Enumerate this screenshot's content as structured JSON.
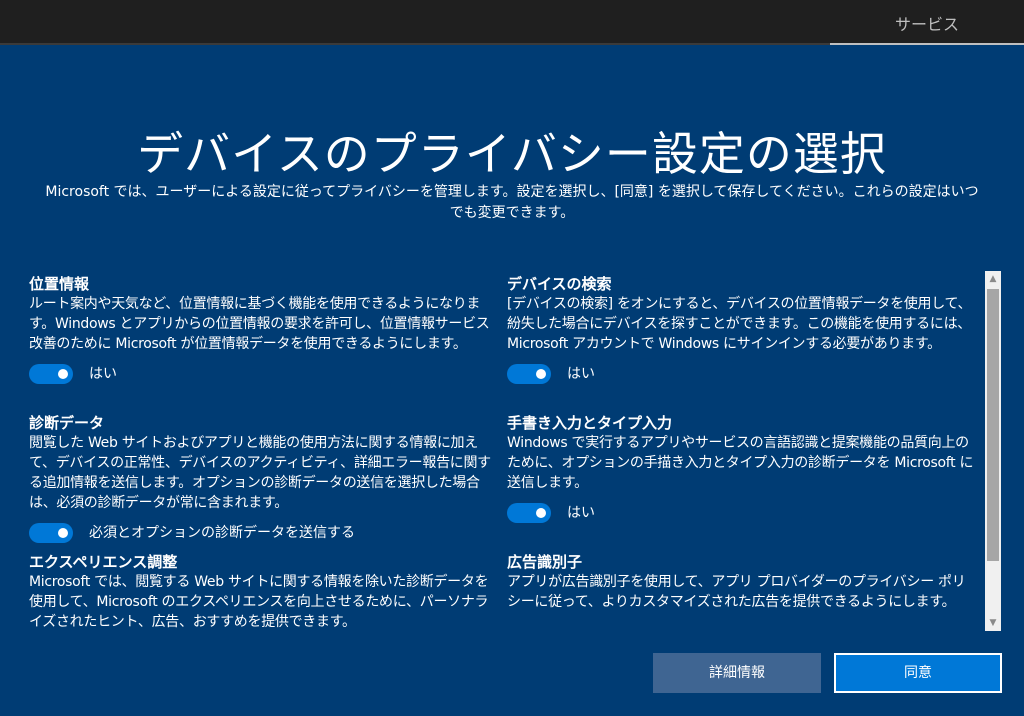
{
  "header": {
    "services_tab": "サービス"
  },
  "main": {
    "title": "デバイスのプライバシー設定の選択",
    "subtitle": "Microsoft では、ユーザーによる設定に従ってプライバシーを管理します。設定を選択し、[同意] を選択して保存してください。これらの設定はいつでも変更できます。"
  },
  "settings": {
    "location": {
      "title": "位置情報",
      "description": "ルート案内や天気など、位置情報に基づく機能を使用できるようになります。Windows とアプリからの位置情報の要求を許可し、位置情報サービス改善のために Microsoft が位置情報データを使用できるようにします。",
      "toggle_label": "はい",
      "enabled": true
    },
    "diagnostics": {
      "title": "診断データ",
      "description": "閲覧した Web サイトおよびアプリと機能の使用方法に関する情報に加えて、デバイスの正常性、デバイスのアクティビティ、詳細エラー報告に関する追加情報を送信します。オプションの診断データの送信を選択した場合は、必須の診断データが常に含まれます。",
      "toggle_label": "必須とオプションの診断データを送信する",
      "enabled": true
    },
    "tailored": {
      "title": "エクスペリエンス調整",
      "description": "Microsoft では、閲覧する Web サイトに関する情報を除いた診断データを使用して、Microsoft のエクスペリエンスを向上させるために、パーソナライズされたヒント、広告、おすすめを提供できます。"
    },
    "find_device": {
      "title": "デバイスの検索",
      "description": "[デバイスの検索] をオンにすると、デバイスの位置情報データを使用して、紛失した場合にデバイスを探すことができます。この機能を使用するには、Microsoft アカウントで Windows にサインインする必要があります。",
      "toggle_label": "はい",
      "enabled": true
    },
    "inking": {
      "title": "手書き入力とタイプ入力",
      "description": "Windows で実行するアプリやサービスの言語認識と提案機能の品質向上のために、オプションの手描き入力とタイプ入力の診断データを Microsoft に送信します。",
      "toggle_label": "はい",
      "enabled": true
    },
    "advertising": {
      "title": "広告識別子",
      "description": "アプリが広告識別子を使用して、アプリ プロバイダーのプライバシー ポリシーに従って、よりカスタマイズされた広告を提供できるようにします。"
    }
  },
  "buttons": {
    "details": "詳細情報",
    "agree": "同意"
  },
  "colors": {
    "background": "#003c74",
    "accent": "#0078d7",
    "secondary_button": "#3f6592"
  }
}
